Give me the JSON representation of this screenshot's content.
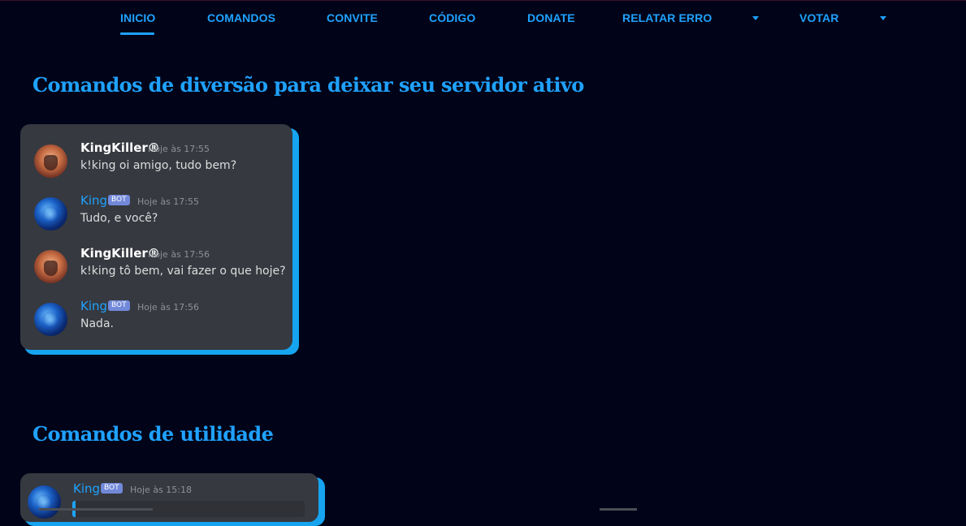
{
  "nav": {
    "items": [
      "INICIO",
      "COMANDOS",
      "CONVITE",
      "CÓDIGO",
      "DONATE",
      "RELATAR ERRO",
      "VOTAR"
    ],
    "active": "INICIO",
    "accent": "#1fa2ff"
  },
  "sections": [
    {
      "title": "Comandos de diversão para deixar seu servidor ativo",
      "messages": [
        {
          "author": "KingKiller®",
          "bot": false,
          "time": "Hoje às 17:55",
          "text": "k!king oi amigo, tudo bem?"
        },
        {
          "author": "King",
          "bot": true,
          "badge": "BOT",
          "time": "Hoje às 17:55",
          "text": "Tudo, e você?"
        },
        {
          "author": "KingKiller®",
          "bot": false,
          "time": "Hoje às 17:56",
          "text": "k!king tô bem, vai fazer o que hoje?"
        },
        {
          "author": "King",
          "bot": true,
          "badge": "BOT",
          "time": "Hoje às 17:56",
          "text": "Nada."
        }
      ]
    },
    {
      "title": "Comandos de utilidade",
      "messages": [
        {
          "author": "King",
          "bot": true,
          "badge": "BOT",
          "time": "Hoje às 15:18",
          "text": ""
        }
      ]
    }
  ],
  "colors": {
    "background": "#010418",
    "card": "#36393f",
    "card_glow": "#16a4f0",
    "bot_badge": "#7289da",
    "timestamp": "#8e9297",
    "message_text": "#dcddde"
  }
}
